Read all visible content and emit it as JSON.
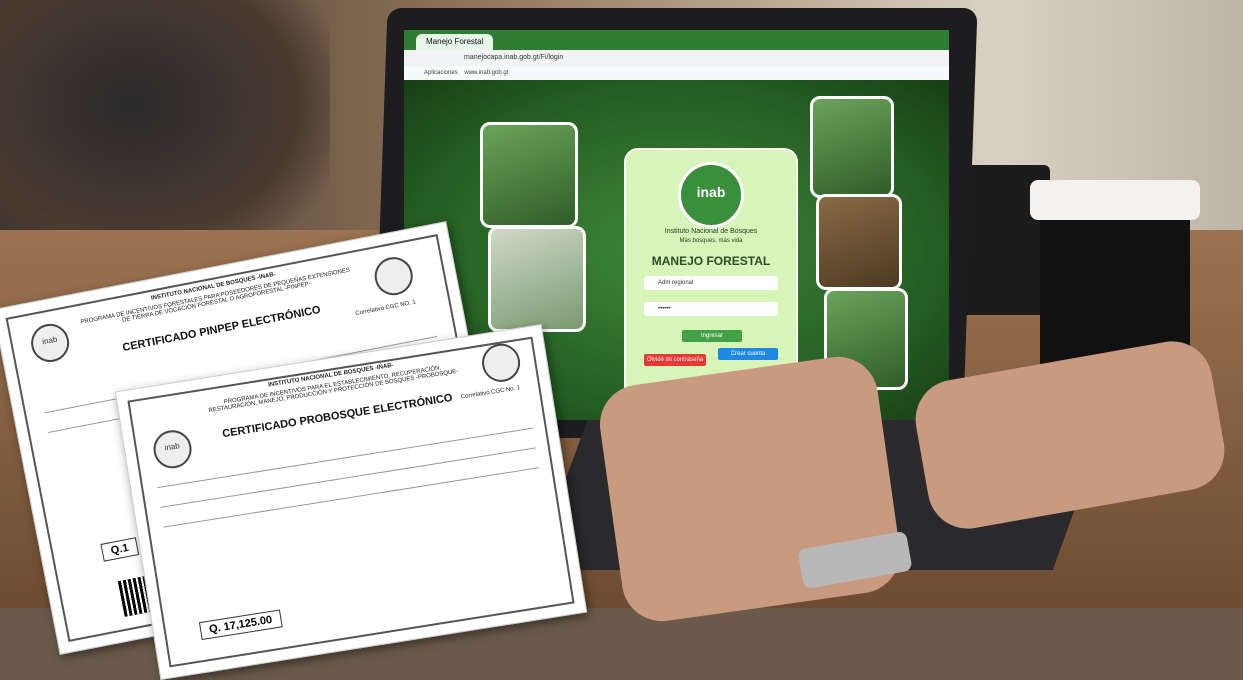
{
  "browser": {
    "tab_title": "Manejo Forestal",
    "url": "manejocapa.inab.gob.gt/Fi/login",
    "bookmarks_label": "Aplicaciones",
    "bookmark_site": "www.inab.gob.gt"
  },
  "login": {
    "logo_text": "inab",
    "org_name": "Instituto Nacional de Bosques",
    "motto": "Más bosques, más vida",
    "app_title": "MANEJO FORESTAL",
    "user_value": "Adm regional",
    "password_value": "••••••",
    "login_button": "Ingresar",
    "forgot_button": "Olvidé mi contraseña",
    "create_button": "Crear cuenta"
  },
  "certificate_back": {
    "institution": "INSTITUTO NACIONAL DE BOSQUES -INAB-",
    "program": "PROGRAMA DE INCENTIVOS FORESTALES PARA POSEEDORES DE PEQUEÑAS EXTENSIONES DE TIERRA DE VOCACIÓN FORESTAL O AGROFORESTAL -PINPEP-",
    "title": "CERTIFICADO PINPEP ELECTRÓNICO",
    "correlative": "Correlativo CGC NO. 1",
    "logo_text": "inab",
    "amount_prefix": "Q.1"
  },
  "certificate_front": {
    "institution": "INSTITUTO NACIONAL DE BOSQUES -INAB-",
    "program": "PROGRAMA DE INCENTIVOS PARA EL ESTABLECIMIENTO, RECUPERACIÓN, RESTAURACIÓN, MANEJO, PRODUCCIÓN Y PROTECCIÓN DE BOSQUES -PROBOSQUE-",
    "title": "CERTIFICADO PROBOSQUE ELECTRÓNICO",
    "correlative": "Correlativo CGC No. 1",
    "logo_text": "inab",
    "amount": "Q. 17,125.00"
  }
}
